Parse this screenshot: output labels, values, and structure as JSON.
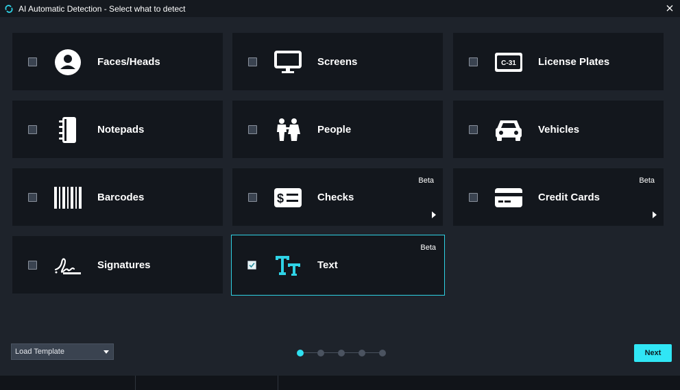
{
  "window": {
    "title": "AI Automatic Detection - Select what to detect"
  },
  "cards": [
    {
      "label": "Faces/Heads",
      "icon": "face-icon",
      "checked": false,
      "beta": "",
      "has_arrow": false
    },
    {
      "label": "Screens",
      "icon": "monitor-icon",
      "checked": false,
      "beta": "",
      "has_arrow": false
    },
    {
      "label": "License Plates",
      "icon": "license-plate-icon",
      "plate_text": "C-31",
      "checked": false,
      "beta": "",
      "has_arrow": false
    },
    {
      "label": "Notepads",
      "icon": "notepad-icon",
      "checked": false,
      "beta": "",
      "has_arrow": false
    },
    {
      "label": "People",
      "icon": "people-icon",
      "checked": false,
      "beta": "",
      "has_arrow": false
    },
    {
      "label": "Vehicles",
      "icon": "car-icon",
      "checked": false,
      "beta": "",
      "has_arrow": false
    },
    {
      "label": "Barcodes",
      "icon": "barcode-icon",
      "checked": false,
      "beta": "",
      "has_arrow": false
    },
    {
      "label": "Checks",
      "icon": "check-document-icon",
      "checked": false,
      "beta": "Beta",
      "has_arrow": true
    },
    {
      "label": "Credit Cards",
      "icon": "credit-card-icon",
      "checked": false,
      "beta": "Beta",
      "has_arrow": true
    },
    {
      "label": "Signatures",
      "icon": "signature-icon",
      "checked": false,
      "beta": "",
      "has_arrow": false
    },
    {
      "label": "Text",
      "icon": "text-icon",
      "checked": true,
      "beta": "Beta",
      "has_arrow": false
    }
  ],
  "footer": {
    "template_select": "Load Template",
    "pager": {
      "total": 5,
      "current": 1
    },
    "next_label": "Next"
  },
  "colors": {
    "accent": "#30e6f5",
    "background": "#1e232b",
    "card": "#13171d"
  }
}
